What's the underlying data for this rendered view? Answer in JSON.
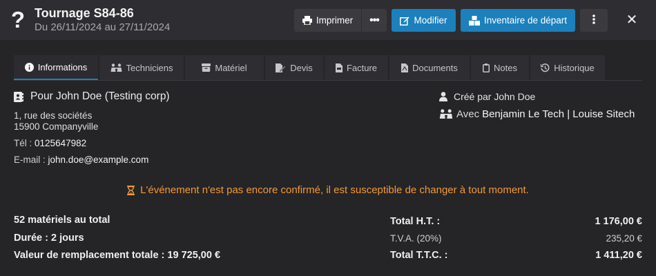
{
  "header": {
    "title": "Tournage S84-86",
    "subtitle": "Du 26/11/2024 au 27/11/2024",
    "buttons": {
      "print": "Imprimer",
      "edit": "Modifier",
      "inventory": "Inventaire de départ"
    }
  },
  "tabs": [
    {
      "label": "Informations",
      "icon": "info-circle-icon",
      "active": true
    },
    {
      "label": "Techniciens",
      "icon": "people-icon"
    },
    {
      "label": "Matériel",
      "icon": "box-icon"
    },
    {
      "label": "Devis",
      "icon": "edit-doc-icon"
    },
    {
      "label": "Facture",
      "icon": "file-invoice-icon"
    },
    {
      "label": "Documents",
      "icon": "file-pdf-icon"
    },
    {
      "label": "Notes",
      "icon": "clipboard-icon"
    },
    {
      "label": "Historique",
      "icon": "history-icon"
    }
  ],
  "client": {
    "label": "Pour John Doe (Testing corp)",
    "address_line1": "1, rue des sociétés",
    "address_line2": "15900 Companyville",
    "tel_label": "Tél :",
    "tel_value": "0125647982",
    "email_label": "E-mail :",
    "email_value": "john.doe@example.com"
  },
  "meta": {
    "created_by": "Créé par John Doe",
    "with_label": "Avec",
    "technicians": "Benjamin Le Tech | Louise Sitech"
  },
  "warning": {
    "text": "L'événement n'est pas encore confirmé, il est susceptible de changer à tout moment.",
    "color": "#f29a36"
  },
  "stats": {
    "materials": "52 matériels au total",
    "duration": "Durée : 2 jours",
    "replacement": "Valeur de remplacement totale : 19 725,00 €"
  },
  "totals": {
    "ht_label": "Total H.T. :",
    "ht_value": "1 176,00 €",
    "tva_label": "T.V.A. (20%)",
    "tva_value": "235,20 €",
    "ttc_label": "Total T.T.C. :",
    "ttc_value": "1 411,20 €"
  },
  "colors": {
    "accent": "#1c80bd",
    "background": "#252427",
    "warning": "#f29a36"
  }
}
